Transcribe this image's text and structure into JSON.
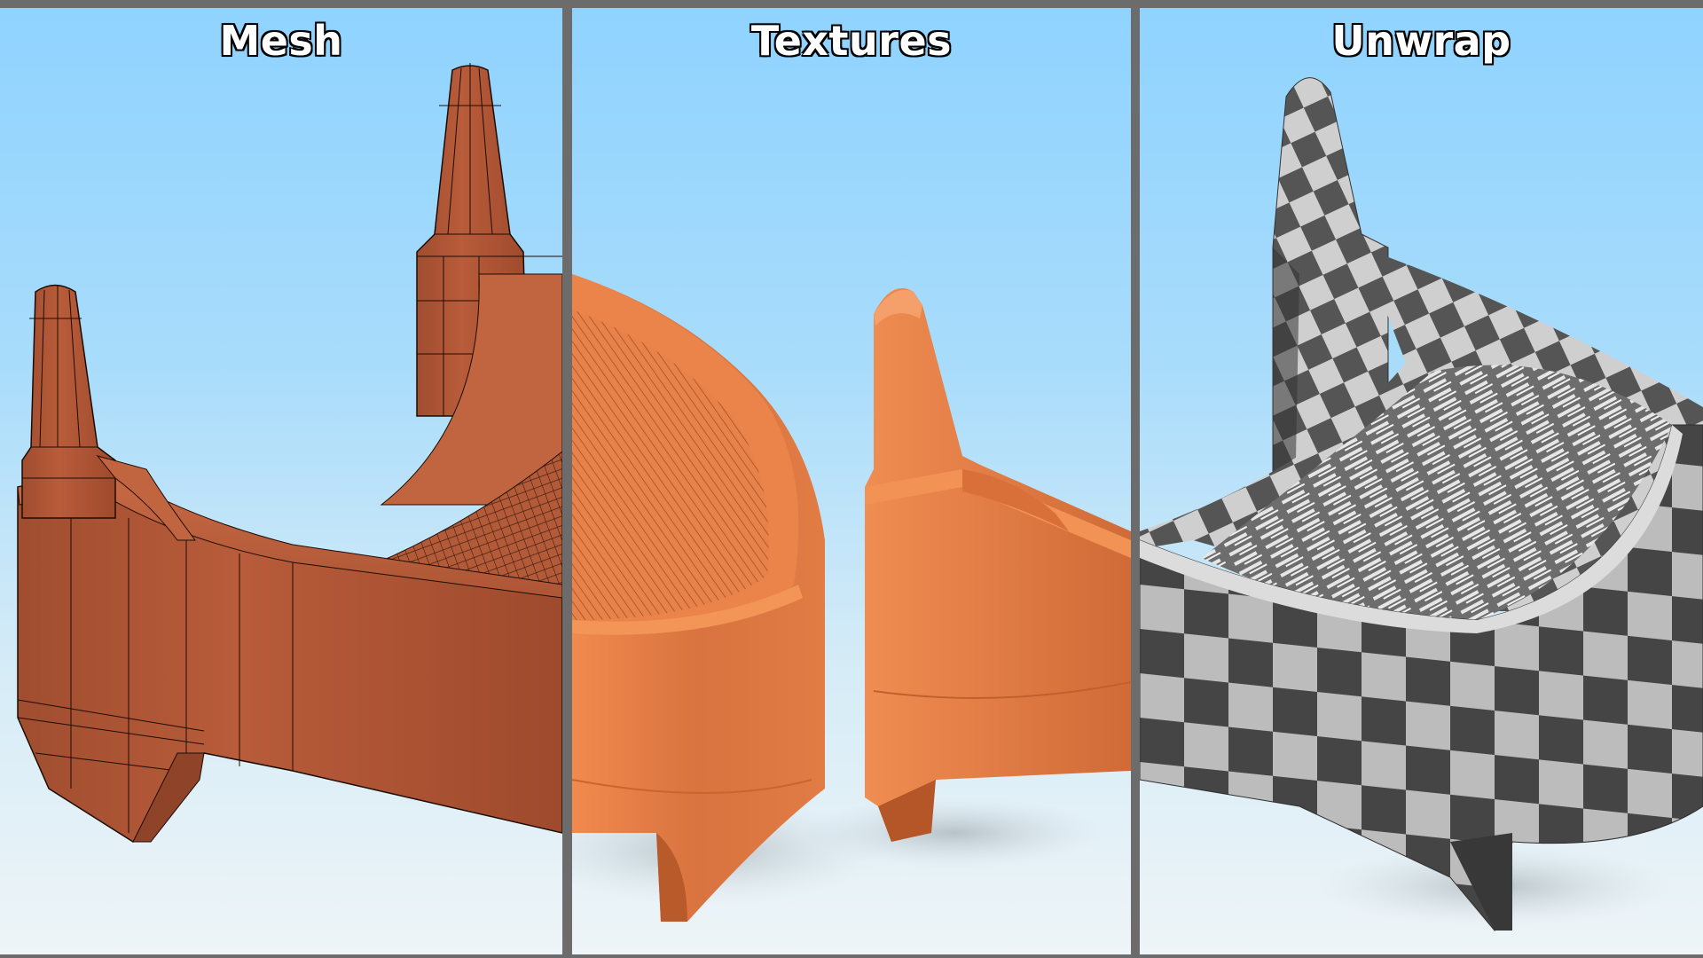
{
  "panels": [
    {
      "id": "mesh",
      "title": "Mesh",
      "render": "wireframe-icon"
    },
    {
      "id": "textures",
      "title": "Textures",
      "render": "textured-model-icon"
    },
    {
      "id": "unwrap",
      "title": "Unwrap",
      "render": "uv-checker-icon"
    }
  ],
  "colors": {
    "mesh_body": "#b85c3a",
    "texture_body": "#e8824a",
    "checker_dark": "#474747",
    "checker_light": "#bfbfbf",
    "sky_top": "#8fd3ff",
    "sky_bottom": "#eef4f7",
    "divider": "#6c6c6c"
  }
}
